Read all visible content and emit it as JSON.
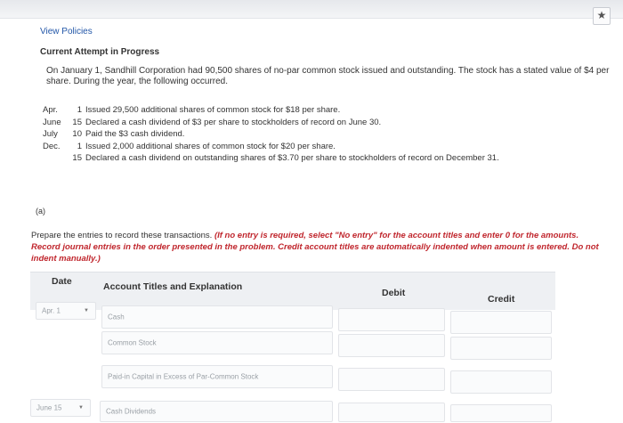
{
  "header": {
    "link": "View Policies",
    "attempt": "Current Attempt in Progress"
  },
  "problem": {
    "intro": "On January 1, Sandhill Corporation had 90,500 shares of no-par common stock issued and outstanding. The stock has a stated value of $4 per share. During the year, the following occurred.",
    "events": [
      {
        "month": "Apr.",
        "day": "1",
        "text": "Issued 29,500 additional shares of common stock for $18 per share."
      },
      {
        "month": "June",
        "day": "15",
        "text": "Declared a cash dividend of $3 per share to stockholders of record on June 30."
      },
      {
        "month": "July",
        "day": "10",
        "text": "Paid the $3 cash dividend."
      },
      {
        "month": "Dec.",
        "day": "1",
        "text": "Issued 2,000 additional shares of common stock for $20 per share."
      },
      {
        "month": "",
        "day": "15",
        "text": "Declared a cash dividend on outstanding shares of $3.70 per share to stockholders of record on December 31."
      }
    ]
  },
  "part": "(a)",
  "instructions": {
    "normal": "Prepare the entries to record these transactions. ",
    "red": "(If no entry is required, select \"No entry\" for the account titles and enter 0 for the amounts. Record journal entries in the order presented in the problem. Credit account titles are automatically indented when amount is entered. Do not indent manually.)"
  },
  "table": {
    "headers": {
      "date": "Date",
      "account": "Account Titles and Explanation",
      "debit": "Debit",
      "credit": "Credit"
    },
    "rows": [
      {
        "date": "Apr. 1",
        "account": "Cash"
      },
      {
        "date": "",
        "account": "Common Stock"
      },
      {
        "date": "",
        "account": "Paid-in Capital in Excess of Par-Common Stock"
      },
      {
        "date": "June 15",
        "account": "Cash Dividends"
      }
    ]
  },
  "icons": {
    "bookmark": "star-icon",
    "dropdown": "chevron-down-icon"
  },
  "colors": {
    "link": "#2357a8",
    "instruction_red": "#c0262d",
    "header_bg": "#eef0f3"
  }
}
